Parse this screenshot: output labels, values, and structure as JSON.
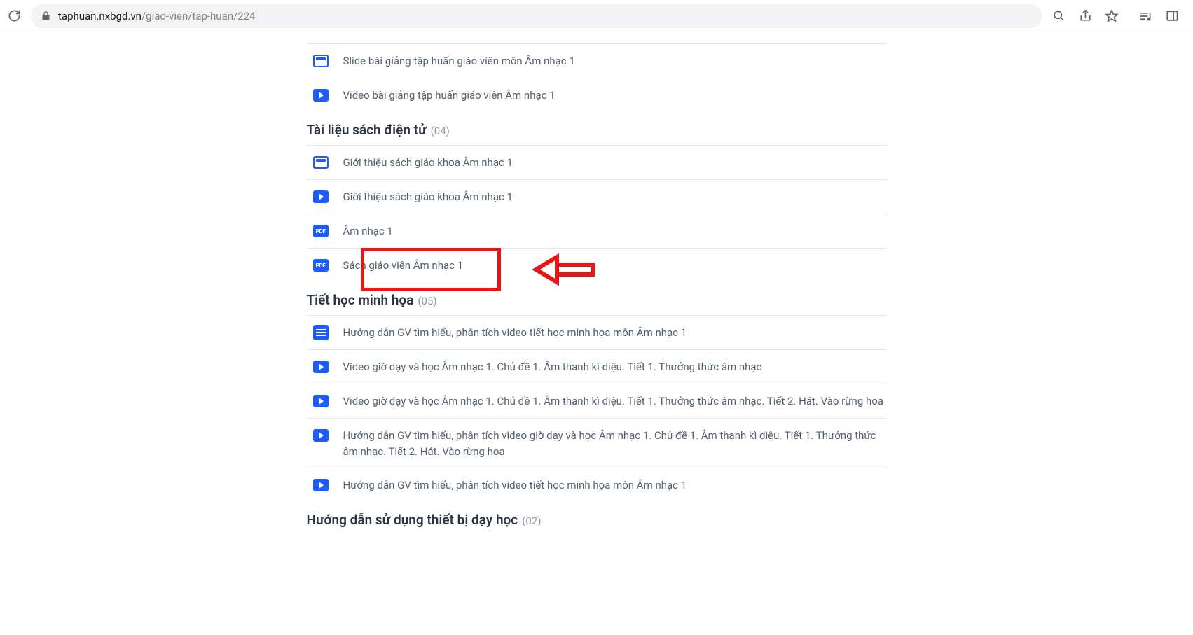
{
  "browser": {
    "url_host": "taphuan.nxbgd.vn",
    "url_path": "/giao-vien/tap-huan/224"
  },
  "top_items": [
    {
      "icon": "slide",
      "label": "Slide bài giảng tập huấn giáo viên môn Âm nhạc 1"
    },
    {
      "icon": "video",
      "label": "Video bài giảng tập huấn giáo viên Âm nhạc 1"
    }
  ],
  "sections": [
    {
      "title": "Tài liệu sách điện tử",
      "count": "(04)",
      "items": [
        {
          "icon": "slide",
          "label": "Giới thiệu sách giáo khoa Âm nhạc 1"
        },
        {
          "icon": "video",
          "label": "Giới thiệu sách giáo khoa Âm nhạc 1"
        },
        {
          "icon": "pdf",
          "label": "Âm nhạc 1",
          "highlighted": true
        },
        {
          "icon": "pdf",
          "label": "Sách giáo viên Âm nhạc 1"
        }
      ]
    },
    {
      "title": "Tiết học minh họa",
      "count": "(05)",
      "items": [
        {
          "icon": "doc",
          "label": "Hướng dẫn GV tìm hiểu, phân tích video tiết học minh họa môn Âm nhạc 1"
        },
        {
          "icon": "video",
          "label": "Video giờ dạy và học Âm nhạc 1. Chủ đề 1. Âm thanh kì diệu. Tiết 1. Thưởng thức âm nhạc"
        },
        {
          "icon": "video",
          "label": "Video giờ dạy và học Âm nhạc 1. Chủ đề 1. Âm thanh kì diệu. Tiết 1. Thưởng thức âm nhạc. Tiết 2. Hát. Vào rừng hoa"
        },
        {
          "icon": "video",
          "label": "Hướng dẫn GV tìm hiểu, phân tích video giờ dạy và học Âm nhạc 1. Chủ đề 1. Âm thanh kì diệu. Tiết 1. Thưởng thức âm nhạc. Tiết 2. Hát. Vào rừng hoa"
        },
        {
          "icon": "video",
          "label": "Hướng dẫn GV tìm hiểu, phân tích video tiết học minh họa môn Âm nhạc 1"
        }
      ]
    },
    {
      "title": "Hướng dẫn sử dụng thiết bị dạy học",
      "count": "(02)",
      "items": []
    }
  ],
  "icon_pdf_text": "PDF"
}
